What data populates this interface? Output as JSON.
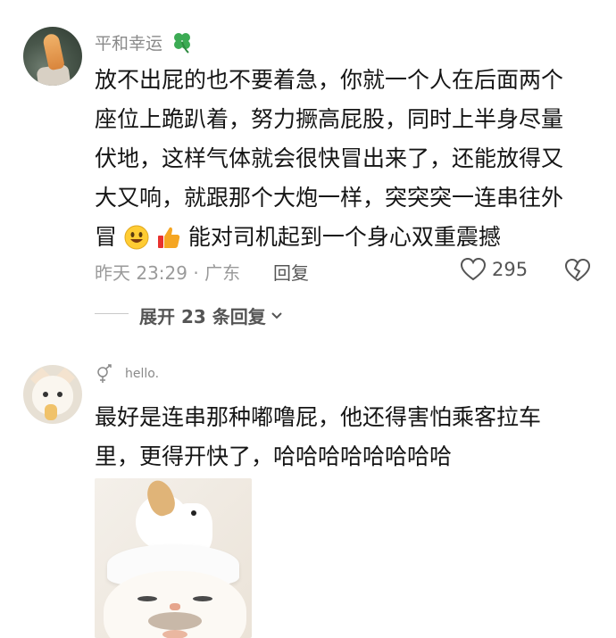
{
  "comments": [
    {
      "username": "平和幸运",
      "badge_icon": "four-leaf-clover-icon",
      "lines": [
        "放不出屁的也不要着急，你就一个人在后面两个",
        "座位上跪趴着，努力撅高屁股，同时上半身尽量",
        "伏地，这样气体就会很快冒出来了，还能放得又",
        "大又响，就跟那个大炮一样，突突突一连串往外",
        "冒"
      ],
      "line_tail": "能对司机起到一个身心双重震撼",
      "inline_emojis": [
        "grinning-face-icon",
        "thumbs-up-icon"
      ],
      "time_location": "昨天 23:29 · 广东",
      "reply_label": "回复",
      "like_count": "295",
      "expand_label": "展开 23 条回复"
    },
    {
      "username": "hello.",
      "lines": [
        "最好是连串那种嘟噜屁，他还得害怕乘客拉车",
        "里，更得开快了，哈哈哈哈哈哈哈哈"
      ],
      "has_image": true
    }
  ],
  "colors": {
    "text": "#151515",
    "meta": "#9a9a9a",
    "clover": "#3cab54",
    "thumb": "#f5a623",
    "smiley": "#ffcc33"
  }
}
